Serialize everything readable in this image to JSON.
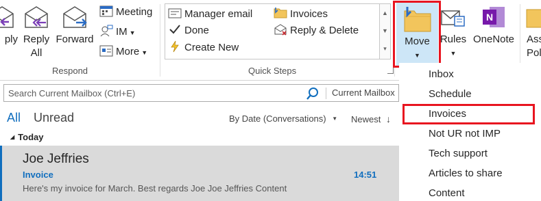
{
  "ribbon": {
    "respond": {
      "reply_partial": "ply",
      "reply_all_line1": "Reply",
      "reply_all_line2": "All",
      "forward": "Forward",
      "meeting": "Meeting",
      "im": "IM",
      "more": "More",
      "group_label": "Respond"
    },
    "quick_steps": {
      "items": [
        "Manager email",
        "Done",
        "Create New",
        "Invoices",
        "Reply & Delete"
      ],
      "group_label": "Quick Steps"
    },
    "move": {
      "label": "Move"
    },
    "rules": {
      "label": "Rules"
    },
    "onenote": {
      "label": "OneNote"
    },
    "assign_policy": {
      "line1": "Ass",
      "line2": "Pol"
    }
  },
  "search": {
    "placeholder": "Search Current Mailbox (Ctrl+E)",
    "scope": "Current Mailbox"
  },
  "filters": {
    "all": "All",
    "unread": "Unread",
    "sort": "By Date (Conversations)",
    "order": "Newest"
  },
  "message_list": {
    "group_header": "Today",
    "messages": [
      {
        "from": "Joe Jeffries",
        "subject": "Invoice",
        "time": "14:51",
        "preview": "Here's my invoice for March.  Best regards  Joe  Joe Jeffries  Content"
      }
    ]
  },
  "move_menu": {
    "items": [
      "Inbox",
      "Schedule",
      "Invoices",
      "Not UR not IMP",
      "Tech support",
      "Articles to share",
      "Content"
    ]
  },
  "colors": {
    "accent": "#106ebe",
    "highlight": "#e8141f",
    "selected_row": "#dadada",
    "move_button_bg": "#cde6f7",
    "onenote_purple": "#7719aa"
  }
}
